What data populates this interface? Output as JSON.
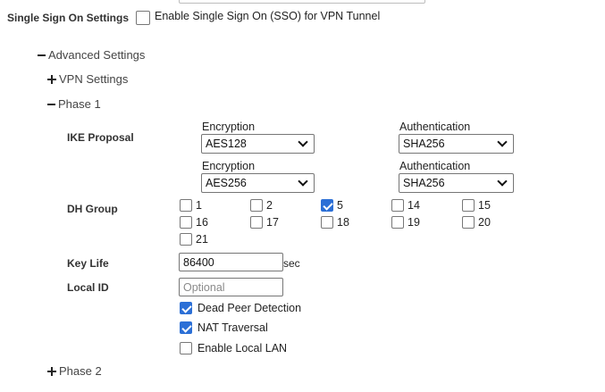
{
  "sso": {
    "label": "Single Sign On Settings",
    "checkbox_label": "Enable Single Sign On (SSO) for VPN Tunnel",
    "checked": false
  },
  "tree": {
    "advanced": "Advanced Settings",
    "vpn_settings": "VPN Settings",
    "phase1": "Phase 1",
    "phase2": "Phase 2"
  },
  "ike": {
    "label": "IKE Proposal",
    "proposals": [
      {
        "enc_label": "Encryption",
        "enc_value": "AES128",
        "auth_label": "Authentication",
        "auth_value": "SHA256"
      },
      {
        "enc_label": "Encryption",
        "enc_value": "AES256",
        "auth_label": "Authentication",
        "auth_value": "SHA256"
      }
    ]
  },
  "dh": {
    "label": "DH Group",
    "options": [
      {
        "value": "1",
        "checked": false
      },
      {
        "value": "2",
        "checked": false
      },
      {
        "value": "5",
        "checked": true
      },
      {
        "value": "14",
        "checked": false
      },
      {
        "value": "15",
        "checked": false
      },
      {
        "value": "16",
        "checked": false
      },
      {
        "value": "17",
        "checked": false
      },
      {
        "value": "18",
        "checked": false
      },
      {
        "value": "19",
        "checked": false
      },
      {
        "value": "20",
        "checked": false
      },
      {
        "value": "21",
        "checked": false
      }
    ]
  },
  "key_life": {
    "label": "Key Life",
    "value": "86400",
    "unit": "sec"
  },
  "local_id": {
    "label": "Local ID",
    "value": "",
    "placeholder": "Optional"
  },
  "options": {
    "dpd": {
      "label": "Dead Peer Detection",
      "checked": true
    },
    "nat": {
      "label": "NAT Traversal",
      "checked": true
    },
    "local_lan": {
      "label": "Enable Local LAN",
      "checked": false
    }
  },
  "colors": {
    "check_accent": "#2b6fd6"
  }
}
